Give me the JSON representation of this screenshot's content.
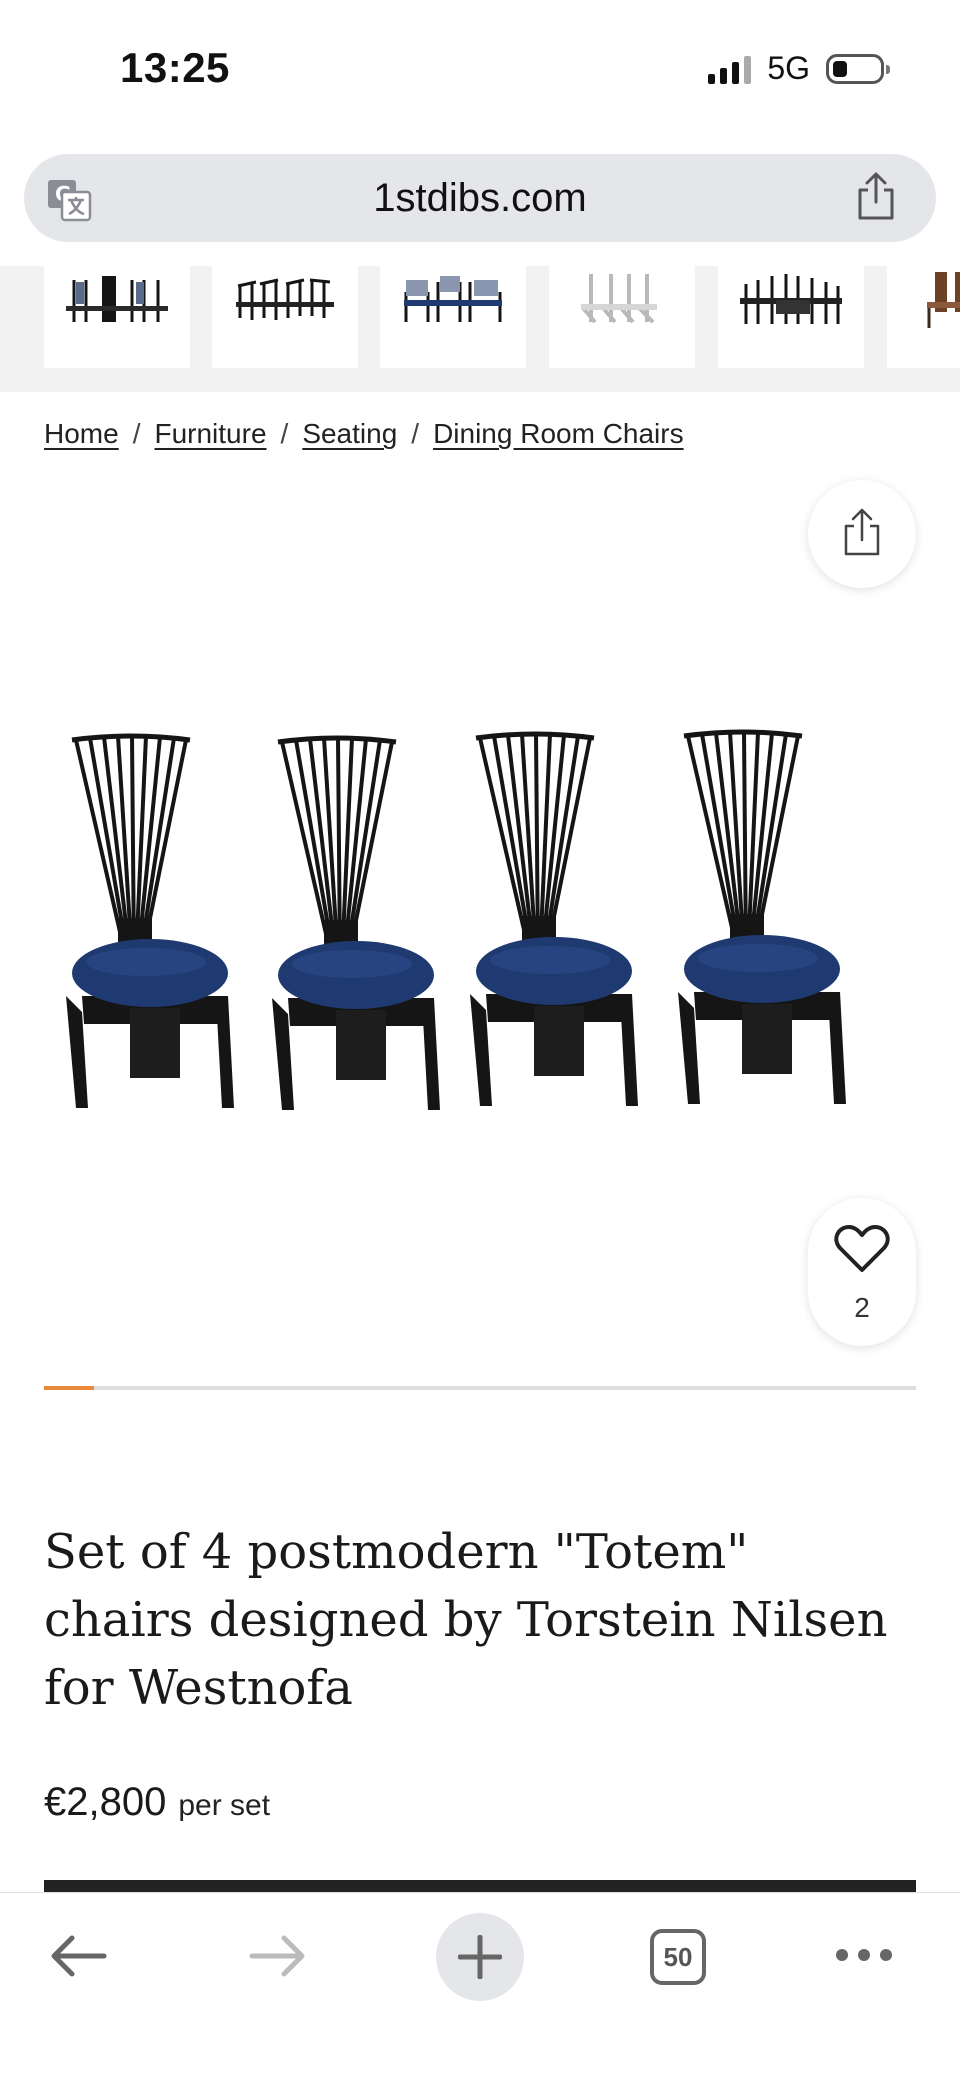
{
  "status_bar": {
    "time": "13:25",
    "network": "5G"
  },
  "browser": {
    "url": "1stdibs.com",
    "tab_count": "50"
  },
  "thumbnails": [
    {
      "alt": "black chairs set thumbnail"
    },
    {
      "alt": "black chairs set thumbnail"
    },
    {
      "alt": "blue seat chairs thumbnail"
    },
    {
      "alt": "white chairs thumbnail"
    },
    {
      "alt": "black chairs table thumbnail"
    },
    {
      "alt": "brown chairs thumbnail"
    }
  ],
  "breadcrumb": {
    "items": [
      "Home",
      "Furniture",
      "Seating",
      "Dining Room Chairs"
    ],
    "separator": "/"
  },
  "product": {
    "title": "Set of 4 postmodern \"Totem\" chairs designed by Torstein Nilsen for Westnofa",
    "price": "€2,800",
    "price_unit": "per set",
    "favorites_count": "2",
    "gallery_progress": 0.057
  },
  "colors": {
    "accent": "#e8893a",
    "chair_frame": "#151515",
    "chair_seat": "#1f3a70",
    "url_bar": "#e5e6e9"
  }
}
